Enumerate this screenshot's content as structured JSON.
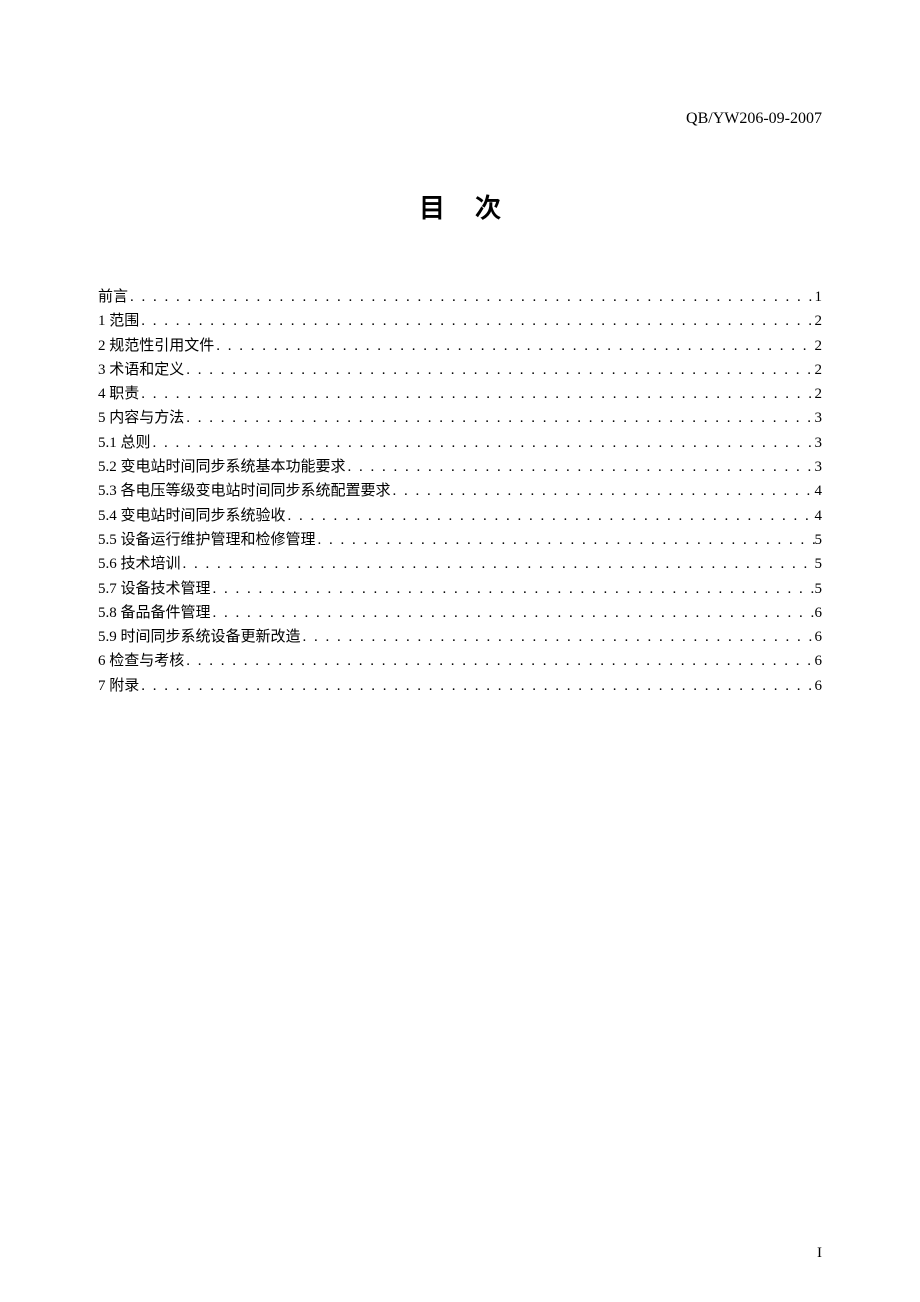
{
  "header": {
    "code": "QB/YW206-09-2007"
  },
  "title": "目次",
  "toc": {
    "entries": [
      {
        "label": "前言",
        "page": "1"
      },
      {
        "label": "1 范围",
        "page": "2"
      },
      {
        "label": "2 规范性引用文件",
        "page": "2"
      },
      {
        "label": "3 术语和定义",
        "page": "2"
      },
      {
        "label": "4 职责",
        "page": "2"
      },
      {
        "label": "5 内容与方法",
        "page": "3"
      },
      {
        "label": "5.1 总则",
        "page": "3"
      },
      {
        "label": "5.2 变电站时间同步系统基本功能要求",
        "page": "3"
      },
      {
        "label": "5.3 各电压等级变电站时间同步系统配置要求",
        "page": "4"
      },
      {
        "label": "5.4 变电站时间同步系统验收",
        "page": "4"
      },
      {
        "label": "5.5 设备运行维护管理和检修管理",
        "page": "5"
      },
      {
        "label": "5.6 技术培训",
        "page": "5"
      },
      {
        "label": "5.7 设备技术管理",
        "page": "5"
      },
      {
        "label": "5.8 备品备件管理",
        "page": "6"
      },
      {
        "label": "5.9 时间同步系统设备更新改造",
        "page": "6"
      },
      {
        "label": "6 检查与考核",
        "page": "6"
      },
      {
        "label": "7 附录",
        "page": "6"
      }
    ]
  },
  "pageNumber": "I"
}
